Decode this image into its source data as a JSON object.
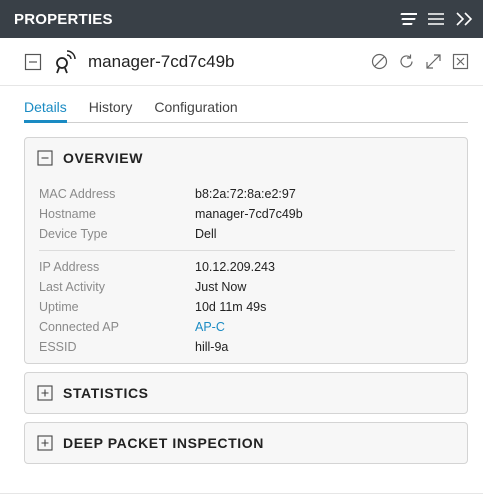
{
  "header": {
    "title": "PROPERTIES"
  },
  "device": {
    "name": "manager-7cd7c49b"
  },
  "tabs": [
    {
      "label": "Details",
      "active": true
    },
    {
      "label": "History",
      "active": false
    },
    {
      "label": "Configuration",
      "active": false
    }
  ],
  "overview": {
    "title": "OVERVIEW",
    "group1": [
      {
        "label": "MAC Address",
        "value": "b8:2a:72:8a:e2:97"
      },
      {
        "label": "Hostname",
        "value": "manager-7cd7c49b"
      },
      {
        "label": "Device Type",
        "value": "Dell"
      }
    ],
    "group2": [
      {
        "label": "IP Address",
        "value": "10.12.209.243"
      },
      {
        "label": "Last Activity",
        "value": "Just Now"
      },
      {
        "label": "Uptime",
        "value": "10d 11m 49s"
      },
      {
        "label": "Connected AP",
        "value": "AP-C"
      },
      {
        "label": "ESSID",
        "value": "hill-9a"
      }
    ]
  },
  "statistics": {
    "title": "STATISTICS"
  },
  "dpi": {
    "title": "DEEP PACKET INSPECTION"
  },
  "colors": {
    "header_bg": "#394047",
    "accent": "#1a8bc3"
  }
}
